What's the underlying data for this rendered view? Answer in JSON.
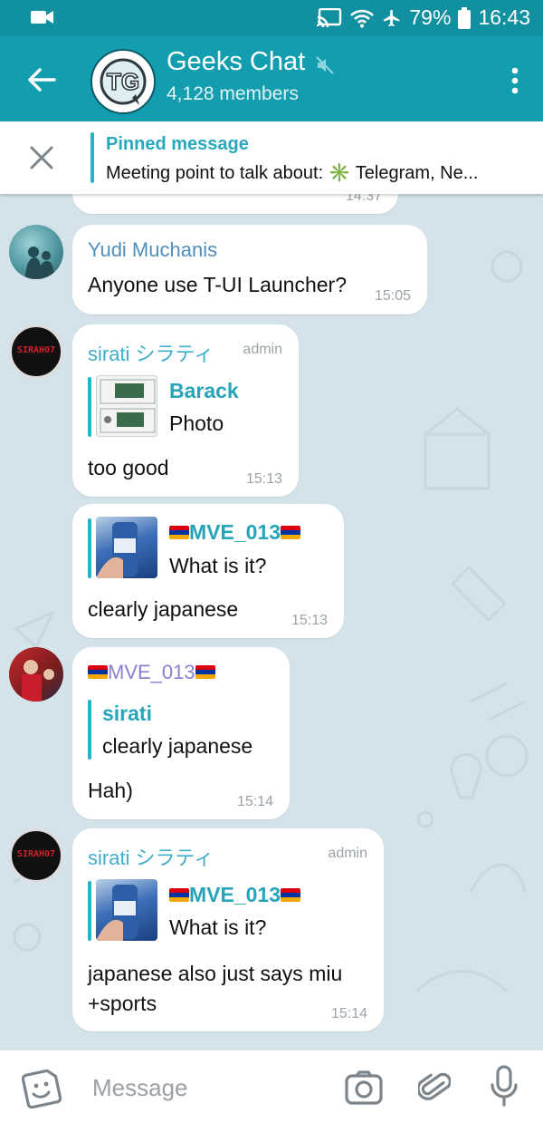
{
  "statusbar": {
    "battery": "79%",
    "time": "16:43"
  },
  "header": {
    "avatar_text": "TG",
    "title": "Geeks Chat",
    "subtitle": "4,128 members"
  },
  "pinned": {
    "title": "Pinned message",
    "text": "Meeting point to talk about: ✳️ Telegram, Ne..."
  },
  "partial_time": "14:37",
  "messages": [
    {
      "sender": "Yudi Muchanis",
      "text": "Anyone use T-UI Launcher?",
      "time": "15:05"
    },
    {
      "sender": "sirati シラティ",
      "badge": "admin",
      "reply_name": "Barack",
      "reply_text": "Photo",
      "text": "too good",
      "time": "15:13"
    },
    {
      "reply_name": "MVE_013",
      "reply_text": "What is it?",
      "text": "clearly japanese",
      "time": "15:13"
    },
    {
      "sender": "MVE_013",
      "reply_name": "sirati",
      "reply_text": "clearly japanese",
      "text": "Hah)",
      "time": "15:14"
    },
    {
      "sender": "sirati シラティ",
      "badge": "admin",
      "reply_name": "MVE_013",
      "reply_text": "What is it?",
      "text_line1": "japanese also just says miu",
      "text_line2": "+sports",
      "time": "15:14"
    }
  ],
  "avatars": {
    "sirati_label": "SIRAH07"
  },
  "composer": {
    "placeholder": "Message"
  },
  "icons": {
    "back": "arrow-left-icon",
    "mute": "muted-speaker-icon",
    "menu": "more-vert-icon",
    "close": "close-icon",
    "emoji": "sticker-emoji-icon",
    "camera": "camera-icon",
    "attach": "paperclip-icon",
    "mic": "microphone-icon"
  },
  "colors": {
    "header": "#139eaf",
    "statusbar": "#1190a0",
    "accent": "#24b6c8",
    "chat_bg": "#d4e2ea"
  }
}
